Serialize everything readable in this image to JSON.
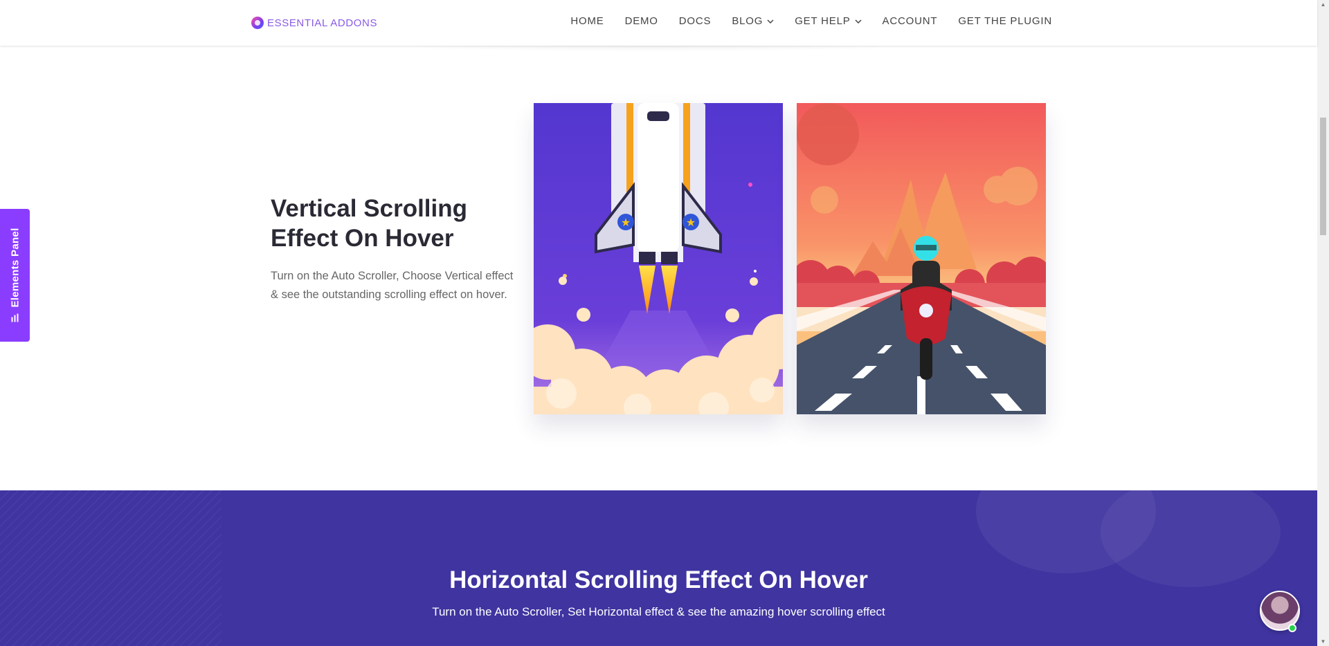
{
  "header": {
    "logo_text": "ESSENTIAL ADDONS",
    "nav": [
      {
        "label": "HOME",
        "dropdown": false
      },
      {
        "label": "DEMO",
        "dropdown": false
      },
      {
        "label": "DOCS",
        "dropdown": false
      },
      {
        "label": "BLOG",
        "dropdown": true
      },
      {
        "label": "GET HELP",
        "dropdown": true
      },
      {
        "label": "ACCOUNT",
        "dropdown": false
      },
      {
        "label": "GET THE PLUGIN",
        "dropdown": false
      }
    ]
  },
  "elements_panel": {
    "label": "Elements Panel",
    "icon": "bar-chart-icon"
  },
  "section_vertical": {
    "title": "Vertical Scrolling Effect On Hover",
    "description": "Turn on the Auto Scroller, Choose Vertical effect & see the outstanding scrolling effect on hover.",
    "images": [
      "rocket-launch-illustration",
      "motorbike-road-illustration"
    ]
  },
  "section_horizontal": {
    "title": "Horizontal Scrolling Effect On Hover",
    "description": "Turn on the Auto Scroller, Set Horizontal effect & see the amazing hover scrolling effect"
  },
  "colors": {
    "brand_purple": "#8b3dff",
    "section_bg": "#3f34a0",
    "rocket_bg": "#5b3cd6",
    "sunset_top": "#f2665a"
  }
}
